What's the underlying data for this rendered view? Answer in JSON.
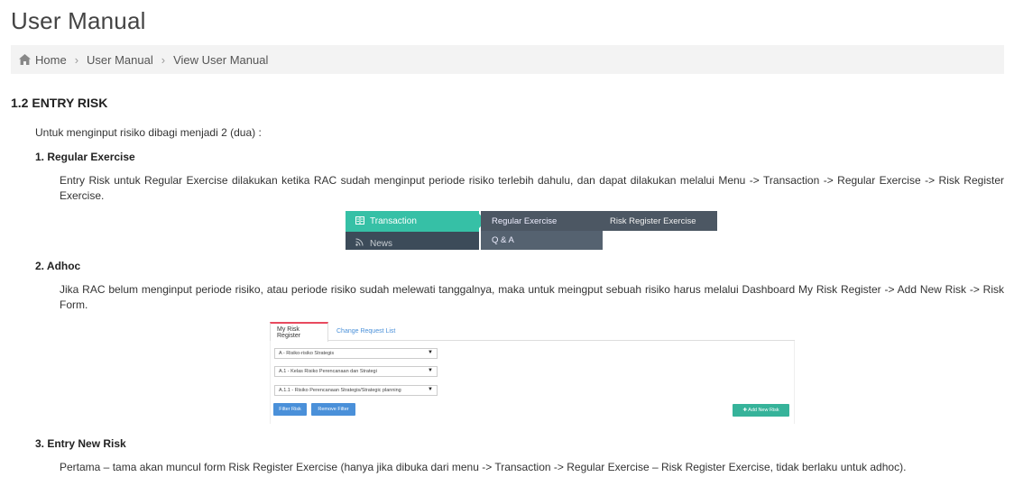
{
  "page": {
    "title": "User Manual"
  },
  "breadcrumb": {
    "home_icon": "home-icon",
    "items": [
      "Home",
      "User Manual",
      "View User Manual"
    ]
  },
  "content": {
    "section_title": "1.2 ENTRY RISK",
    "intro": "Untuk menginput risiko dibagi menjadi 2 (dua) :",
    "steps": [
      {
        "heading": "1. Regular Exercise",
        "text": "Entry Risk untuk Regular Exercise dilakukan ketika RAC sudah menginput periode risiko terlebih dahulu, dan dapat dilakukan melalui Menu -> Transaction -> Regular Exercise -> Risk Register Exercise."
      },
      {
        "heading": "2. Adhoc",
        "text": "Jika RAC belum menginput periode risiko, atau periode risiko sudah melewati tanggalnya, maka untuk meingput sebuah risiko harus melalui Dashboard My Risk Register -> Add New Risk -> Risk Form."
      },
      {
        "heading": "3. Entry New Risk",
        "text": "Pertama – tama akan muncul form Risk Register Exercise (hanya jika dibuka dari menu -> Transaction -> Regular Exercise – Risk Register Exercise, tidak berlaku untuk adhoc)."
      }
    ]
  },
  "menu_screenshot": {
    "left_items": [
      "Transaction",
      "News"
    ],
    "mid_items": [
      "Regular Exercise",
      "Q & A"
    ],
    "right_items": [
      "Risk Register Exercise"
    ],
    "colors": {
      "active": "#36c0a6",
      "dark": "#3c4b59",
      "mid": "#556270"
    }
  },
  "risk_register_screenshot": {
    "tabs": [
      "My Risk Register",
      "Change Request List"
    ],
    "selects": [
      "A - Risiko-risiko Strategis",
      "A.1 - Kelas Risiko Perencanaan dan Strategi",
      "A.1.1 - Risiko Perencanaan Strategis/Strategic planning"
    ],
    "buttons": {
      "filter": "Filter Risk",
      "remove": "Remove Filter",
      "add": "✚ Add New Risk"
    },
    "colors": {
      "blue": "#4a90d9",
      "green": "#36b39a",
      "tab_accent": "#e84a5f"
    }
  }
}
